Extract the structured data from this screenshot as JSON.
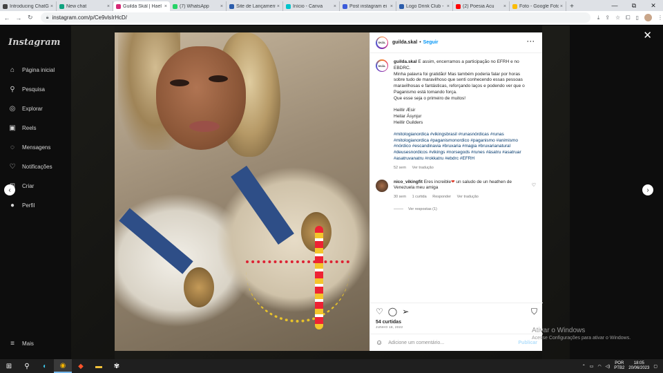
{
  "browser": {
    "tabs": [
      {
        "label": "Introducing ChatG",
        "color": "#444"
      },
      {
        "label": "New chat",
        "color": "#10a37f"
      },
      {
        "label": "Guilda Skál | Hael",
        "color": "#d62976",
        "active": true
      },
      {
        "label": "(7) WhatsApp",
        "color": "#25d366"
      },
      {
        "label": "Site de Lançament",
        "color": "#2b5cab"
      },
      {
        "label": "Início - Canva",
        "color": "#00c4cc"
      },
      {
        "label": "Post instagram ei",
        "color": "#3b5bdb"
      },
      {
        "label": "Logo Drink Club -",
        "color": "#2b5cab"
      },
      {
        "label": "(2) Poesia Acu",
        "color": "#ff0000"
      },
      {
        "label": "Foto - Google Foto",
        "color": "#fbbc05"
      }
    ],
    "new_tab": "+",
    "url": "instagram.com/p/Ce9vlsIrHcD/",
    "window_controls": [
      "—",
      "⧉",
      "✕"
    ]
  },
  "instagram": {
    "logo": "Instagram",
    "nav": [
      {
        "label": "Página inicial",
        "icon": "home-icon",
        "glyph": "⌂"
      },
      {
        "label": "Pesquisa",
        "icon": "search-icon",
        "glyph": "⚲"
      },
      {
        "label": "Explorar",
        "icon": "explore-icon",
        "glyph": "◎"
      },
      {
        "label": "Reels",
        "icon": "reels-icon",
        "glyph": "▣"
      },
      {
        "label": "Mensagens",
        "icon": "messenger-icon",
        "glyph": "◌"
      },
      {
        "label": "Notificações",
        "icon": "heart-icon",
        "glyph": "♡"
      },
      {
        "label": "Criar",
        "icon": "create-icon",
        "glyph": "⊞"
      },
      {
        "label": "Perfil",
        "icon": "profile-icon",
        "glyph": "●"
      }
    ],
    "more": {
      "label": "Mais",
      "glyph": "≡"
    }
  },
  "post": {
    "username": "guilda.skal",
    "avatar_text": "SKÅL",
    "follow": "Seguir",
    "caption_lines": [
      "E assim, encerramos a participação no EFRH e no",
      "EBDRC.",
      "Minha palavra foi gratidão! Mas também poderia falar por horas",
      "sobre tudo de maravilhoso que senti conhecendo essas pessoas",
      "maravilhosas e fantásticas, reforçando laços e podendo ver que o",
      "Paganismo está tomando força.",
      "Que esse seja o primeiro de muitos!",
      "",
      "Heillir Æsir",
      "Heilar Ásynjur",
      "Heillir Guilders"
    ],
    "hashtags": [
      "#mitologianordica #vikingsbrasil #runasnórdicas #runas",
      "#mitologianordica #paganismonordico #paganismo #animismo",
      "#nórdico #escandinavia #bruxaria #magia #bruxarianatural",
      "#deusesnordicos #vikings #norsegods #runes #ásatru #asatruar",
      "#asatruvanatru #rokkatru #ebdrc #EFRH"
    ],
    "caption_age": "52 sem",
    "translate": "Ver tradução",
    "comment": {
      "user": "nico_vikingfit",
      "text_a": "Eres increible",
      "text_b": " un saludo de un heathen de",
      "text_c": "Venezuela meu amiga",
      "age": "30 sem",
      "likes": "1 curtida",
      "reply": "Responder",
      "translate": "Ver tradução"
    },
    "view_replies": "Ver respostas (1)",
    "likes": "54 curtidas",
    "date": "JUNHO 18, 2022",
    "add_comment_placeholder": "Adicione um comentário...",
    "publish": "Publicar"
  },
  "windows": {
    "activate_title": "Ativar o Windows",
    "activate_sub": "Acesse Configurações para ativar o Windows.",
    "lang_top": "POR",
    "lang_bottom": "PTB2",
    "time": "18:05",
    "date": "20/06/2023"
  }
}
